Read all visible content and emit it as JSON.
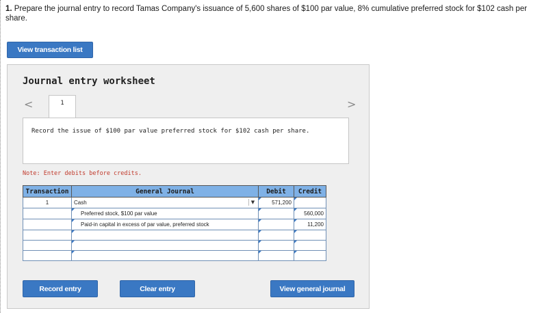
{
  "question": {
    "number": "1.",
    "text": "Prepare the journal entry to record Tamas Company's issuance of 5,600 shares of $100 par value, 8% cumulative preferred stock for $102 cash per share."
  },
  "buttons": {
    "view_transactions": "View transaction list",
    "record_entry": "Record entry",
    "clear_entry": "Clear entry",
    "view_journal": "View general journal"
  },
  "worksheet": {
    "title": "Journal entry worksheet",
    "prev_arrow": "<",
    "next_arrow": ">",
    "tab_label": "1",
    "description": "Record the issue of $100 par value preferred stock for $102 cash per share.",
    "note": "Note: Enter debits before credits."
  },
  "table": {
    "headers": [
      "Transaction",
      "General Journal",
      "Debit",
      "Credit"
    ],
    "rows": [
      {
        "transaction": "1",
        "account": "Cash",
        "debit": "571,200",
        "credit": ""
      },
      {
        "transaction": "",
        "account": "Preferred stock, $100 par value",
        "debit": "",
        "credit": "560,000"
      },
      {
        "transaction": "",
        "account": "Paid-in capital in excess of par value, preferred stock",
        "debit": "",
        "credit": "11,200"
      },
      {
        "transaction": "",
        "account": "",
        "debit": "",
        "credit": ""
      },
      {
        "transaction": "",
        "account": "",
        "debit": "",
        "credit": ""
      },
      {
        "transaction": "",
        "account": "",
        "debit": "",
        "credit": ""
      }
    ]
  },
  "colors": {
    "button_blue": "#3a78c3",
    "header_blue": "#7fb1e6",
    "note_red": "#c0392b",
    "worksheet_bg": "#efefef"
  },
  "icons": {
    "prev": "chevron-left-icon",
    "next": "chevron-right-icon",
    "dropdown": "chevron-down-icon"
  }
}
